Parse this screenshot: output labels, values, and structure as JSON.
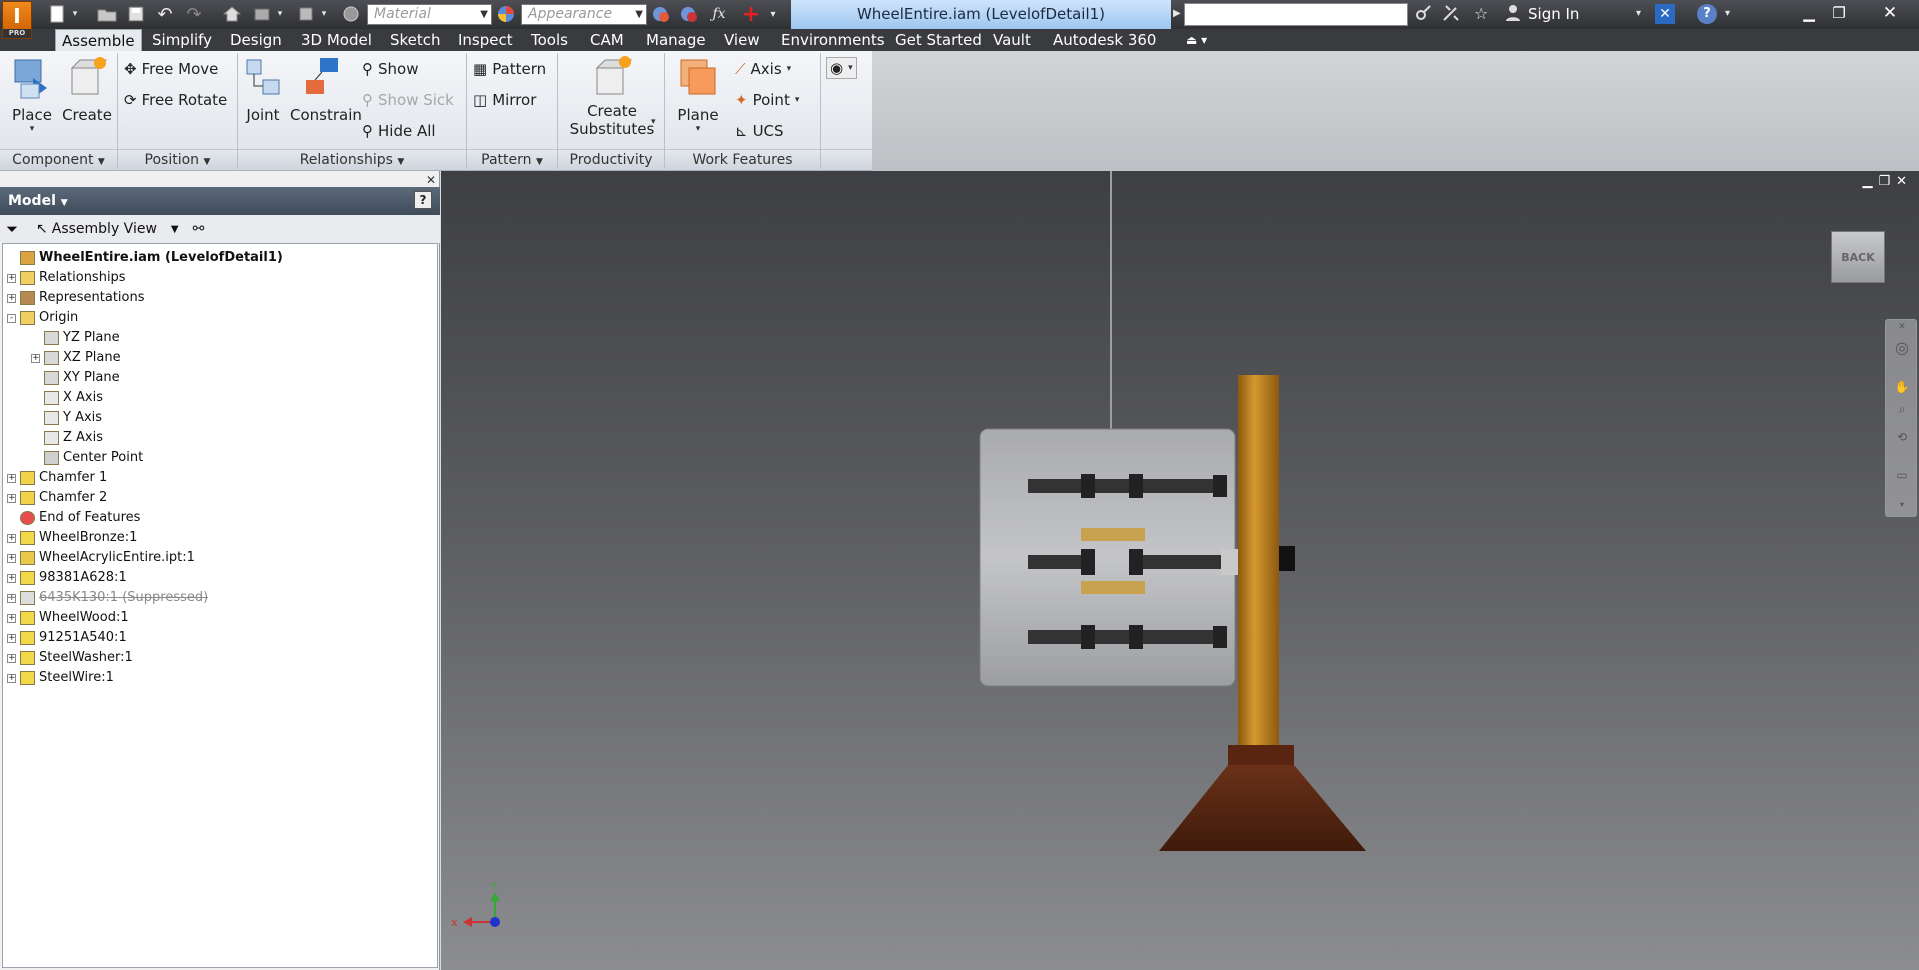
{
  "app": {
    "logo_letter": "I",
    "logo_edition": "PRO"
  },
  "quick_access": {
    "material_placeholder": "Material",
    "appearance_placeholder": "Appearance"
  },
  "title_bar": {
    "document_title": "WheelEntire.iam (LevelofDetail1)",
    "signin_label": "Sign In"
  },
  "ribbon_tabs": [
    {
      "label": "Assemble",
      "active": true
    },
    {
      "label": "Simplify"
    },
    {
      "label": "Design"
    },
    {
      "label": "3D Model"
    },
    {
      "label": "Sketch"
    },
    {
      "label": "Inspect"
    },
    {
      "label": "Tools"
    },
    {
      "label": "CAM"
    },
    {
      "label": "Manage"
    },
    {
      "label": "View"
    },
    {
      "label": "Environments"
    },
    {
      "label": "Get Started"
    },
    {
      "label": "Vault"
    },
    {
      "label": "Autodesk 360"
    }
  ],
  "ribbon": {
    "component": {
      "label": "Component",
      "place": "Place",
      "create": "Create"
    },
    "position": {
      "label": "Position",
      "free_move": "Free Move",
      "free_rotate": "Free Rotate"
    },
    "relationships": {
      "label": "Relationships",
      "joint": "Joint",
      "constrain": "Constrain",
      "show": "Show",
      "show_sick": "Show Sick",
      "hide_all": "Hide All"
    },
    "pattern": {
      "label": "Pattern",
      "pattern": "Pattern",
      "mirror": "Mirror"
    },
    "productivity": {
      "label": "Productivity",
      "create_line1": "Create",
      "create_line2": "Substitutes"
    },
    "work_features": {
      "label": "Work Features",
      "plane": "Plane",
      "axis": "Axis",
      "point": "Point",
      "ucs": "UCS"
    }
  },
  "browser": {
    "header": "Model",
    "view_label": "Assembly View",
    "tree": [
      {
        "label": "WheelEntire.iam (LevelofDetail1)",
        "icon": "assembly-icon",
        "level": 0,
        "expander": "",
        "root": true
      },
      {
        "label": "Relationships",
        "icon": "folder-icon",
        "level": 0,
        "expander": "+"
      },
      {
        "label": "Representations",
        "icon": "representations-icon",
        "level": 0,
        "expander": "+"
      },
      {
        "label": "Origin",
        "icon": "folder-open-icon",
        "level": 0,
        "expander": "-"
      },
      {
        "label": "YZ Plane",
        "icon": "plane-icon",
        "level": 1,
        "expander": ""
      },
      {
        "label": "XZ Plane",
        "icon": "plane-icon",
        "level": 1,
        "expander": "+"
      },
      {
        "label": "XY Plane",
        "icon": "plane-icon",
        "level": 1,
        "expander": ""
      },
      {
        "label": "X Axis",
        "icon": "axis-icon",
        "level": 1,
        "expander": ""
      },
      {
        "label": "Y Axis",
        "icon": "axis-icon",
        "level": 1,
        "expander": ""
      },
      {
        "label": "Z Axis",
        "icon": "axis-icon",
        "level": 1,
        "expander": ""
      },
      {
        "label": "Center Point",
        "icon": "point-icon",
        "level": 1,
        "expander": ""
      },
      {
        "label": "Chamfer 1",
        "icon": "chamfer-icon",
        "level": 0,
        "expander": "+"
      },
      {
        "label": "Chamfer 2",
        "icon": "chamfer-icon",
        "level": 0,
        "expander": "+"
      },
      {
        "label": "End of Features",
        "icon": "end-of-features-icon",
        "level": 0,
        "expander": ""
      },
      {
        "label": "WheelBronze:1",
        "icon": "part-icon",
        "level": 0,
        "expander": "+"
      },
      {
        "label": "WheelAcrylicEntire.ipt:1",
        "icon": "subassembly-icon",
        "level": 0,
        "expander": "+"
      },
      {
        "label": "98381A628:1",
        "icon": "part-icon",
        "level": 0,
        "expander": "+"
      },
      {
        "label": "6435K130:1 (Suppressed)",
        "icon": "part-suppressed-icon",
        "level": 0,
        "expander": "+",
        "suppressed": true
      },
      {
        "label": "WheelWood:1",
        "icon": "part-icon",
        "level": 0,
        "expander": "+"
      },
      {
        "label": "91251A540:1",
        "icon": "part-icon",
        "level": 0,
        "expander": "+"
      },
      {
        "label": "SteelWasher:1",
        "icon": "part-icon",
        "level": 0,
        "expander": "+"
      },
      {
        "label": "SteelWire:1",
        "icon": "part-icon",
        "level": 0,
        "expander": "+"
      }
    ]
  },
  "viewport": {
    "viewcube_label": "BACK",
    "triad_x": "x",
    "triad_y": "Y"
  }
}
